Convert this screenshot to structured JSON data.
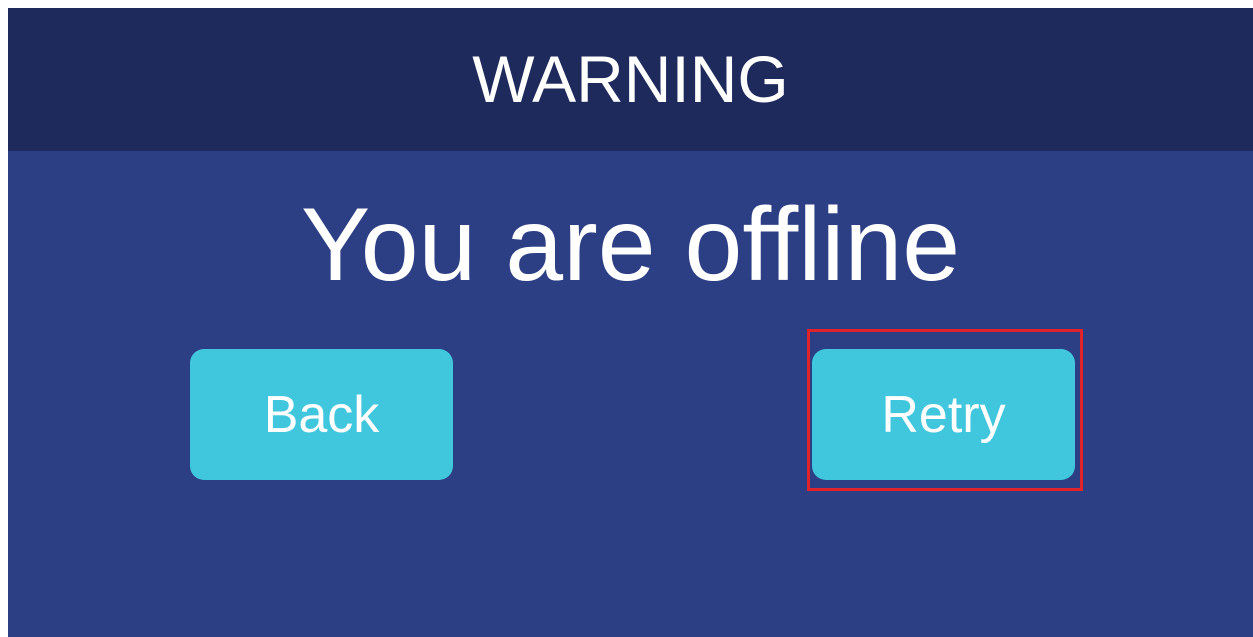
{
  "dialog": {
    "title": "WARNING",
    "message": "You are offline",
    "back_label": "Back",
    "retry_label": "Retry"
  },
  "colors": {
    "header_bg": "#1e2a5c",
    "body_bg": "#2c3f85",
    "button_bg": "#41c7dd",
    "highlight": "#e0232b",
    "text": "#ffffff"
  }
}
